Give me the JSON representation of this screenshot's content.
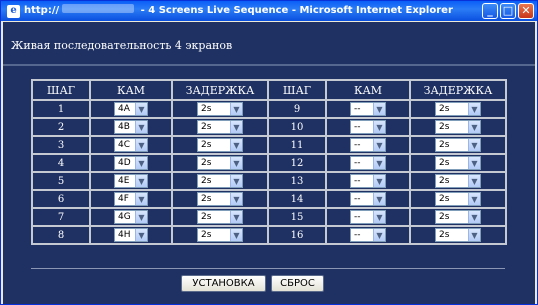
{
  "window": {
    "url_prefix": "http://",
    "title_suffix": " - 4 Screens Live Sequence - Microsoft Internet Explorer"
  },
  "page": {
    "heading": "Живая последовательность 4 экранов"
  },
  "table": {
    "headers": [
      "ШАГ",
      "КАМ",
      "ЗАДЕРЖКА",
      "ШАГ",
      "КАМ",
      "ЗАДЕРЖКА"
    ],
    "left": [
      {
        "step": "1",
        "cam": "4A",
        "delay": "2s"
      },
      {
        "step": "2",
        "cam": "4B",
        "delay": "2s"
      },
      {
        "step": "3",
        "cam": "4C",
        "delay": "2s"
      },
      {
        "step": "4",
        "cam": "4D",
        "delay": "2s"
      },
      {
        "step": "5",
        "cam": "4E",
        "delay": "2s"
      },
      {
        "step": "6",
        "cam": "4F",
        "delay": "2s"
      },
      {
        "step": "7",
        "cam": "4G",
        "delay": "2s"
      },
      {
        "step": "8",
        "cam": "4H",
        "delay": "2s"
      }
    ],
    "right": [
      {
        "step": "9",
        "cam": "--",
        "delay": "2s"
      },
      {
        "step": "10",
        "cam": "--",
        "delay": "2s"
      },
      {
        "step": "11",
        "cam": "--",
        "delay": "2s"
      },
      {
        "step": "12",
        "cam": "--",
        "delay": "2s"
      },
      {
        "step": "13",
        "cam": "--",
        "delay": "2s"
      },
      {
        "step": "14",
        "cam": "--",
        "delay": "2s"
      },
      {
        "step": "15",
        "cam": "--",
        "delay": "2s"
      },
      {
        "step": "16",
        "cam": "--",
        "delay": "2s"
      }
    ]
  },
  "buttons": {
    "set_label": "УСТАНОВКА",
    "reset_label": "СБРОС"
  },
  "colors": {
    "background": "#1f3163",
    "titlebar": "#0a5ef7"
  }
}
